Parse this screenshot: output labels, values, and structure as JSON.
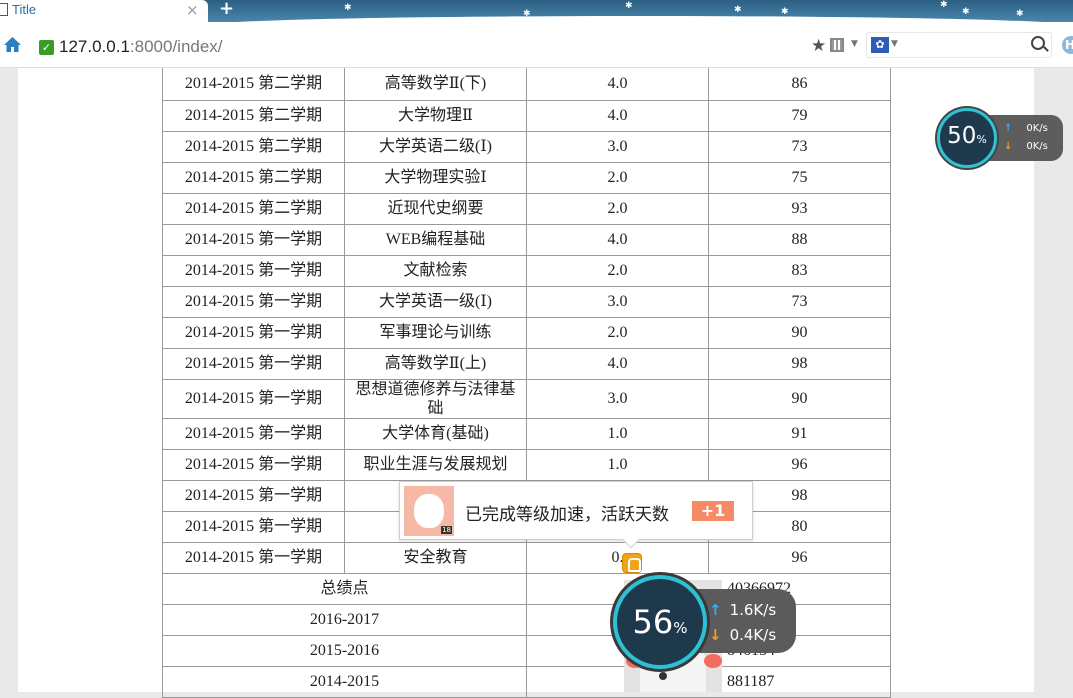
{
  "browser": {
    "tab_title": "Title",
    "new_tab_symbol": "+",
    "close_symbol": "×",
    "url_host": "127.0.0.1",
    "url_rest": ":8000/index/",
    "icons": [
      "home-icon",
      "secure-check-icon",
      "star-icon",
      "qr-code-icon",
      "paw-search-engine-icon",
      "search-icon"
    ]
  },
  "grades": {
    "rows": [
      {
        "term": "2014-2015 第二学期",
        "course": "高等数学Ⅱ(下)",
        "credit": "4.0",
        "score": "86"
      },
      {
        "term": "2014-2015 第二学期",
        "course": "大学物理Ⅱ",
        "credit": "4.0",
        "score": "79"
      },
      {
        "term": "2014-2015 第二学期",
        "course": "大学英语二级(Ⅰ)",
        "credit": "3.0",
        "score": "73"
      },
      {
        "term": "2014-2015 第二学期",
        "course": "大学物理实验Ⅰ",
        "credit": "2.0",
        "score": "75"
      },
      {
        "term": "2014-2015 第二学期",
        "course": "近现代史纲要",
        "credit": "2.0",
        "score": "93"
      },
      {
        "term": "2014-2015 第一学期",
        "course": "WEB编程基础",
        "credit": "4.0",
        "score": "88"
      },
      {
        "term": "2014-2015 第一学期",
        "course": "文献检索",
        "credit": "2.0",
        "score": "83"
      },
      {
        "term": "2014-2015 第一学期",
        "course": "大学英语一级(Ⅰ)",
        "credit": "3.0",
        "score": "73"
      },
      {
        "term": "2014-2015 第一学期",
        "course": "军事理论与训练",
        "credit": "2.0",
        "score": "90"
      },
      {
        "term": "2014-2015 第一学期",
        "course": "高等数学Ⅱ(上)",
        "credit": "4.0",
        "score": "98"
      },
      {
        "term": "2014-2015 第一学期",
        "course": "思想道德修养与法律基础",
        "credit": "3.0",
        "score": "90"
      },
      {
        "term": "2014-2015 第一学期",
        "course": "大学体育(基础)",
        "credit": "1.0",
        "score": "91"
      },
      {
        "term": "2014-2015 第一学期",
        "course": "职业生涯与发展规划",
        "credit": "1.0",
        "score": "96"
      },
      {
        "term": "2014-2015 第一学期",
        "course": "",
        "credit": "",
        "score": "98"
      },
      {
        "term": "2014-2015 第一学期",
        "course": "",
        "credit": "",
        "score": "80"
      },
      {
        "term": "2014-2015 第一学期",
        "course": "安全教育",
        "credit": "0.",
        "score": "96"
      }
    ],
    "gpa_label": "总绩点",
    "gpa_rows": [
      {
        "year": "",
        "value": "40366972"
      },
      {
        "year": "2016-2017",
        "value": "5"
      },
      {
        "year": "2015-2016",
        "value": "846154"
      },
      {
        "year": "2014-2015",
        "value": "881187"
      }
    ]
  },
  "speed_small": {
    "percent": "50",
    "unit": "%",
    "up": "0K/s",
    "down": "0K/s"
  },
  "speed_big": {
    "percent": "56",
    "unit": "%",
    "up": "1.6K/s",
    "down": "0.4K/s"
  },
  "toast": {
    "message": "已完成等级加速，活跃天数",
    "badge": "+1",
    "avatar_tag": "18"
  }
}
